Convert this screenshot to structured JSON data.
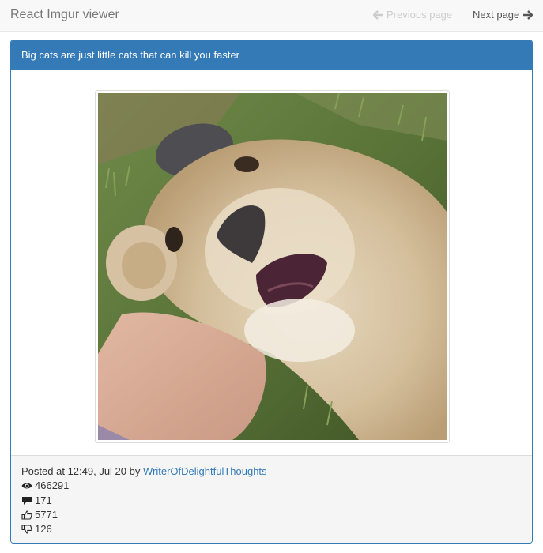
{
  "navbar": {
    "brand": "React Imgur viewer",
    "prev_label": "Previous page",
    "next_label": "Next page"
  },
  "post": {
    "title": "Big cats are just little cats that can kill you faster",
    "image_alt": "Lion cub lying on its back next to a person's arm",
    "posted_prefix": "Posted at",
    "posted_time": "12:49, Jul 20",
    "by_word": "by",
    "author": "WriterOfDelightfulThoughts",
    "stats": {
      "views": "466291",
      "comments": "171",
      "upvotes": "5771",
      "downvotes": "126"
    }
  },
  "colors": {
    "accent": "#337ab7",
    "navbar_bg": "#f8f8f8",
    "footer_bg": "#f5f5f5",
    "disabled": "#cccccc"
  },
  "icons": {
    "prev": "arrow-left-icon",
    "next": "arrow-right-icon",
    "views": "eye-icon",
    "comments": "comment-icon",
    "upvotes": "thumbs-up-icon",
    "downvotes": "thumbs-down-icon"
  }
}
